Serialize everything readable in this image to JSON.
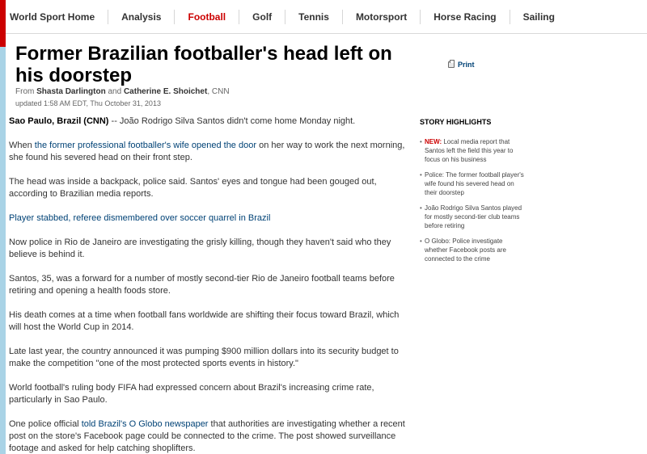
{
  "nav": {
    "items": [
      {
        "label": "World Sport Home"
      },
      {
        "label": "Analysis"
      },
      {
        "label": "Football"
      },
      {
        "label": "Golf"
      },
      {
        "label": "Tennis"
      },
      {
        "label": "Motorsport"
      },
      {
        "label": "Horse Racing"
      },
      {
        "label": "Sailing"
      }
    ],
    "active": "Football",
    "active_color": "#cc0000"
  },
  "article": {
    "headline": "Former Brazilian footballer's head left on his doorstep",
    "byline": {
      "from": "From",
      "author1": "Shasta Darlington",
      "and": "and",
      "author2": "Catherine E. Shoichet",
      "source": ", CNN"
    },
    "updated": "updated 1:58 AM EDT, Thu October 31, 2013",
    "print_label": "Print",
    "paragraphs": {
      "p1_dateline": "Sao Paulo, Brazil (CNN)",
      "p1_text": " -- João Rodrigo Silva Santos didn't come home Monday night.",
      "p2_pre": "When ",
      "p2_link": "the former professional footballer's wife opened the door",
      "p2_post": " on her way to work the next morning, she found his severed head on their front step.",
      "p3": "The head was inside a backpack, police said. Santos' eyes and tongue had been gouged out, according to Brazilian media reports.",
      "p4_link": "Player stabbed, referee dismembered over soccer quarrel in Brazil",
      "p5": "Now police in Rio de Janeiro are investigating the grisly killing, though they haven't said who they believe is behind it.",
      "p6": "Santos, 35, was a forward for a number of mostly second-tier Rio de Janeiro football teams before retiring and opening a health foods store.",
      "p7": "His death comes at a time when football fans worldwide are shifting their focus toward Brazil, which will host the World Cup in 2014.",
      "p8": "Late last year, the country announced it was pumping $900 million dollars into its security budget to make the competition \"one of the most protected sports events in history.\"",
      "p9": "World football's ruling body FIFA had expressed concern about Brazil's increasing crime rate, particularly in Sao Paulo.",
      "p10_pre": "One police official ",
      "p10_link": "told Brazil's O Globo newspaper",
      "p10_post": " that authorities are investigating whether a recent post on the store's Facebook page could be connected to the crime. The post showed surveillance footage and asked for help catching shoplifters."
    }
  },
  "highlights": {
    "title": "STORY HIGHLIGHTS",
    "new_tag": "NEW:",
    "items": [
      " Local media report that Santos left the field this year to focus on his business",
      "Police: The former football player's wife found his severed head on their doorstep",
      "João Rodrigo Silva Santos played for mostly second-tier club teams before retiring",
      "O Globo: Police investigate whether Facebook posts are connected to the crime"
    ]
  }
}
